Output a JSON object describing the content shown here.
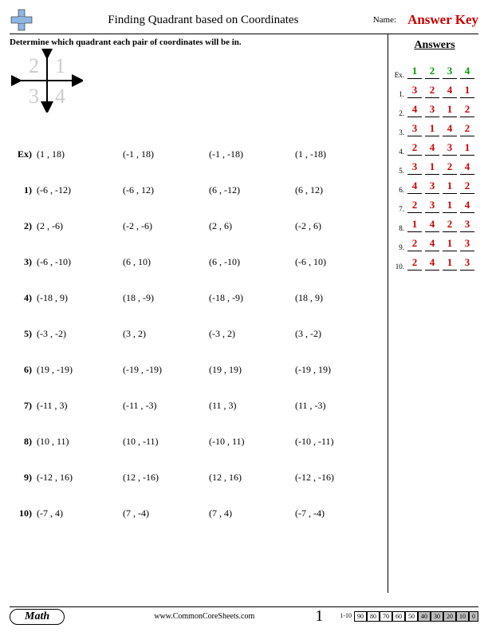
{
  "header": {
    "title": "Finding Quadrant based on Coordinates",
    "name_label": "Name:",
    "answer_key": "Answer Key"
  },
  "instructions": "Determine which quadrant each pair of coordinates will be in.",
  "quadrant_labels": {
    "tl": "2",
    "tr": "1",
    "bl": "3",
    "br": "4"
  },
  "problems": [
    {
      "label": "Ex)",
      "cells": [
        "(1 , 18)",
        "(-1 , 18)",
        "(-1 , -18)",
        "(1 , -18)"
      ]
    },
    {
      "label": "1)",
      "cells": [
        "(-6 , -12)",
        "(-6 , 12)",
        "(6 , -12)",
        "(6 , 12)"
      ]
    },
    {
      "label": "2)",
      "cells": [
        "(2 , -6)",
        "(-2 , -6)",
        "(2 , 6)",
        "(-2 , 6)"
      ]
    },
    {
      "label": "3)",
      "cells": [
        "(-6 , -10)",
        "(6 , 10)",
        "(6 , -10)",
        "(-6 , 10)"
      ]
    },
    {
      "label": "4)",
      "cells": [
        "(-18 , 9)",
        "(18 , -9)",
        "(-18 , -9)",
        "(18 , 9)"
      ]
    },
    {
      "label": "5)",
      "cells": [
        "(-3 , -2)",
        "(3 , 2)",
        "(-3 , 2)",
        "(3 , -2)"
      ]
    },
    {
      "label": "6)",
      "cells": [
        "(19 , -19)",
        "(-19 , -19)",
        "(19 , 19)",
        "(-19 , 19)"
      ]
    },
    {
      "label": "7)",
      "cells": [
        "(-11 , 3)",
        "(-11 , -3)",
        "(11 , 3)",
        "(11 , -3)"
      ]
    },
    {
      "label": "8)",
      "cells": [
        "(10 , 11)",
        "(10 , -11)",
        "(-10 , 11)",
        "(-10 , -11)"
      ]
    },
    {
      "label": "9)",
      "cells": [
        "(-12 , 16)",
        "(12 , -16)",
        "(12 , 16)",
        "(-12 , -16)"
      ]
    },
    {
      "label": "10)",
      "cells": [
        "(-7 , 4)",
        "(7 , -4)",
        "(7 , 4)",
        "(-7 , -4)"
      ]
    }
  ],
  "answers": {
    "title": "Answers",
    "rows": [
      {
        "label": "Ex.",
        "vals": [
          "1",
          "2",
          "3",
          "4"
        ],
        "color": "green"
      },
      {
        "label": "1.",
        "vals": [
          "3",
          "2",
          "4",
          "1"
        ],
        "color": "red"
      },
      {
        "label": "2.",
        "vals": [
          "4",
          "3",
          "1",
          "2"
        ],
        "color": "red"
      },
      {
        "label": "3.",
        "vals": [
          "3",
          "1",
          "4",
          "2"
        ],
        "color": "red"
      },
      {
        "label": "4.",
        "vals": [
          "2",
          "4",
          "3",
          "1"
        ],
        "color": "red"
      },
      {
        "label": "5.",
        "vals": [
          "3",
          "1",
          "2",
          "4"
        ],
        "color": "red"
      },
      {
        "label": "6.",
        "vals": [
          "4",
          "3",
          "1",
          "2"
        ],
        "color": "red"
      },
      {
        "label": "7.",
        "vals": [
          "2",
          "3",
          "1",
          "4"
        ],
        "color": "red"
      },
      {
        "label": "8.",
        "vals": [
          "1",
          "4",
          "2",
          "3"
        ],
        "color": "red"
      },
      {
        "label": "9.",
        "vals": [
          "2",
          "4",
          "1",
          "3"
        ],
        "color": "red"
      },
      {
        "label": "10.",
        "vals": [
          "2",
          "4",
          "1",
          "3"
        ],
        "color": "red"
      }
    ]
  },
  "footer": {
    "badge": "Math",
    "site": "www.CommonCoreSheets.com",
    "page": "1",
    "score_label": "1-10",
    "scores": [
      "90",
      "80",
      "70",
      "60",
      "50",
      "40",
      "30",
      "20",
      "10",
      "0"
    ],
    "shade_from": 5
  }
}
